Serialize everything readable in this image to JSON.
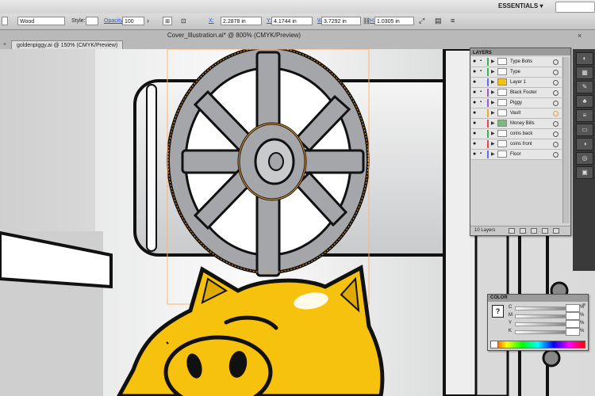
{
  "workspace": {
    "label": "ESSENTIALS ▾"
  },
  "control_bar": {
    "stroke_value": "Wood",
    "style_label": "Style:",
    "opacity_label": "Opacity",
    "opacity_value": "100",
    "x_value": "2.2878 in",
    "y_value": "4.1744 in",
    "w_value": "3.7292 in",
    "h_value": "1.0305 in"
  },
  "document": {
    "window_title": "Cover_Illustration.ai* @ 800% (CMYK/Preview)",
    "tab_label": "goldenpiggy.ai @ 150% (CMYK/Preview)"
  },
  "layers_panel": {
    "tab_label": "LAYERS",
    "layer_count": "10 Layers",
    "layers": [
      {
        "name": "Type Bolts",
        "color": "#39b54a"
      },
      {
        "name": "Type",
        "color": "#39b54a"
      },
      {
        "name": "Layer 1",
        "color": "#5b6cff"
      },
      {
        "name": "Black Footer",
        "color": "#9b59d0"
      },
      {
        "name": "Piggy",
        "color": "#9b59d0"
      },
      {
        "name": "Vault",
        "color": "#f5a623"
      },
      {
        "name": "Money Bills",
        "color": "#e24848"
      },
      {
        "name": "coins back",
        "color": "#39b54a"
      },
      {
        "name": "coins front",
        "color": "#e24848"
      },
      {
        "name": "Floor",
        "color": "#5b6cff"
      }
    ]
  },
  "color_panel": {
    "tab_label": "COLOR",
    "channels": [
      {
        "label": "C",
        "unit": "%"
      },
      {
        "label": "M",
        "unit": "%"
      },
      {
        "label": "Y",
        "unit": "%"
      },
      {
        "label": "K",
        "unit": "%"
      }
    ]
  },
  "colors": {
    "pig_yellow": "#f6c20e",
    "vault_gray": "#a4a6a9",
    "selection_orange": "#f39a2b",
    "outline": "#111111"
  }
}
